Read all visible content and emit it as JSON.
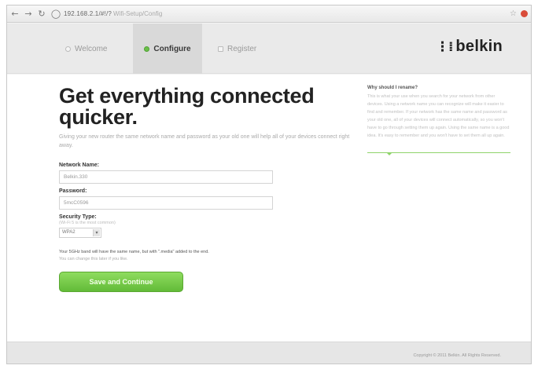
{
  "browser": {
    "url": "192.168.2.1/#!/?",
    "url_rest": "Wifi-Setup/Config"
  },
  "steps": [
    {
      "label": "Welcome",
      "state": "done"
    },
    {
      "label": "Configure",
      "state": "current"
    },
    {
      "label": "Register",
      "state": "upcoming"
    }
  ],
  "brand": {
    "name": "belkin",
    "accent_color": "#6cc04a"
  },
  "main": {
    "heading": "Get everything connected quicker.",
    "lead": "Giving your new router the same network name and password as your old one will help all of your devices connect right away.",
    "network_name_label": "Network Name:",
    "network_name_value": "Belkin.330",
    "password_label": "Password:",
    "password_value": "5mcC0596",
    "security_label": "Security Type:",
    "security_hint": "(Wi-Fi 5 is the most common)",
    "security_value": "WPA2",
    "note": "Your 5GHz band will have the same name, but with \".media\" added to the end.",
    "note2": "You can change this later if you like.",
    "save_label": "Save and Continue"
  },
  "side": {
    "title": "Why should I rename?",
    "body": "This is what your use when you search for your network from other devices. Using a network name you can recognize will make it easier to find and remember. If your network has the same name and password as your old one, all of your devices will connect automatically, so you won't have to go through setting them up again. Using the same name is a good idea. It's easy to remember and you won't have to set them all up again."
  },
  "footer": {
    "copyright": "Copyright © 2011 Belkin. All Rights Reserved."
  }
}
